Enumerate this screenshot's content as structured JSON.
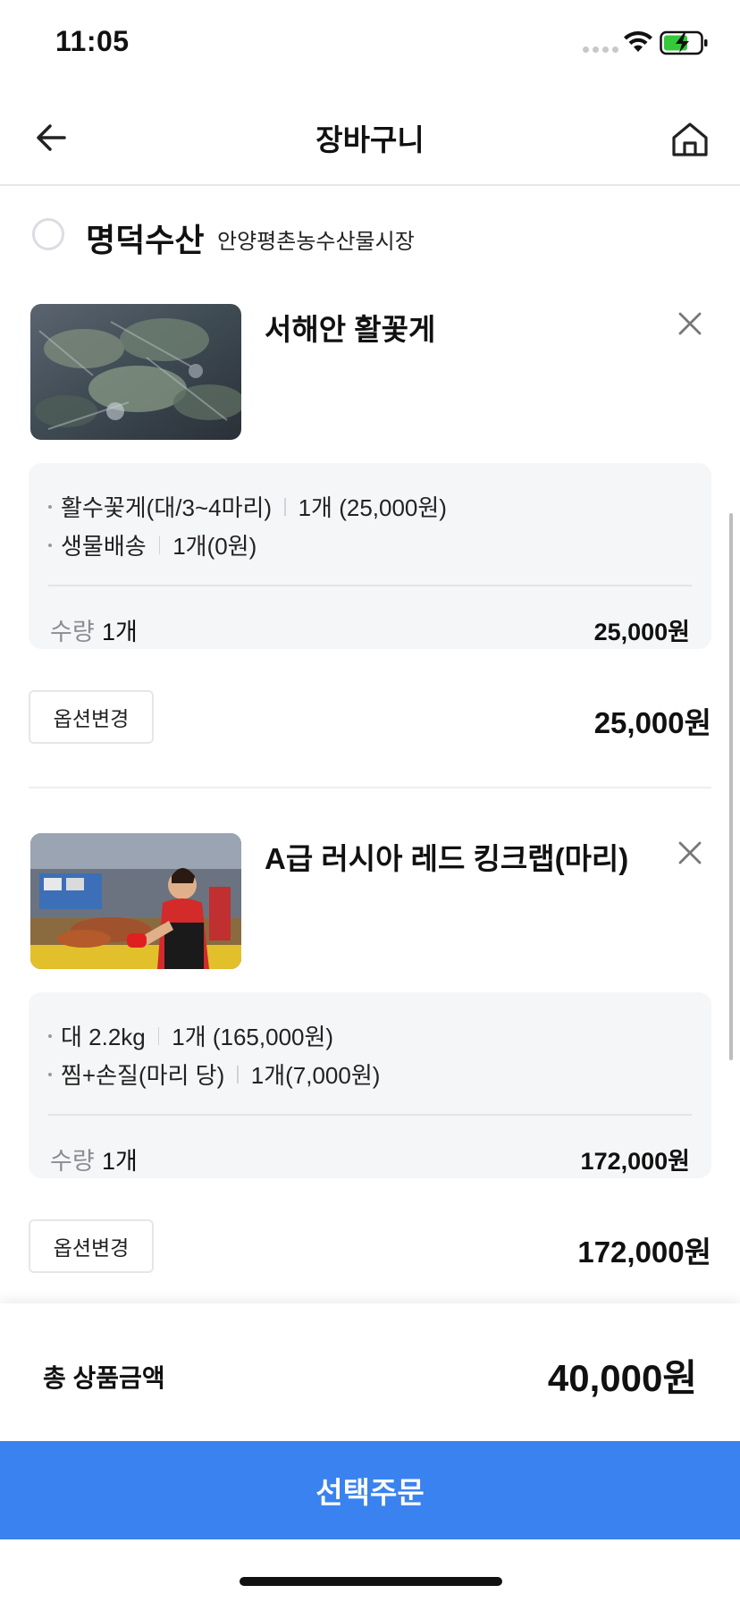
{
  "status_bar": {
    "time": "11:05"
  },
  "header": {
    "title": "장바구니"
  },
  "seller": {
    "name": "명덕수산",
    "market": "안양평촌농수산물시장"
  },
  "products": [
    {
      "name": "서해안 활꽃게",
      "options": [
        {
          "name": "활수꽃게(대/3~4마리)",
          "detail": "1개 (25,000원)"
        },
        {
          "name": "생물배송",
          "detail": "1개(0원)"
        }
      ],
      "quantity_label": "수량",
      "quantity_value": "1개",
      "option_price": "25,000원",
      "change_label": "옵션변경",
      "total": "25,000원"
    },
    {
      "name": "A급 러시아 레드 킹크랩(마리)",
      "options": [
        {
          "name": "대 2.2kg",
          "detail": "1개 (165,000원)"
        },
        {
          "name": "찜+손질(마리 당)",
          "detail": "1개(7,000원)"
        }
      ],
      "quantity_label": "수량",
      "quantity_value": "1개",
      "option_price": "172,000원",
      "change_label": "옵션변경",
      "total": "172,000원"
    }
  ],
  "footer": {
    "total_label": "총 상품금액",
    "total_amount": "40,000원",
    "order_button": "선택주문"
  },
  "colors": {
    "accent": "#3a82ef",
    "option_bg": "#f5f6f8"
  }
}
